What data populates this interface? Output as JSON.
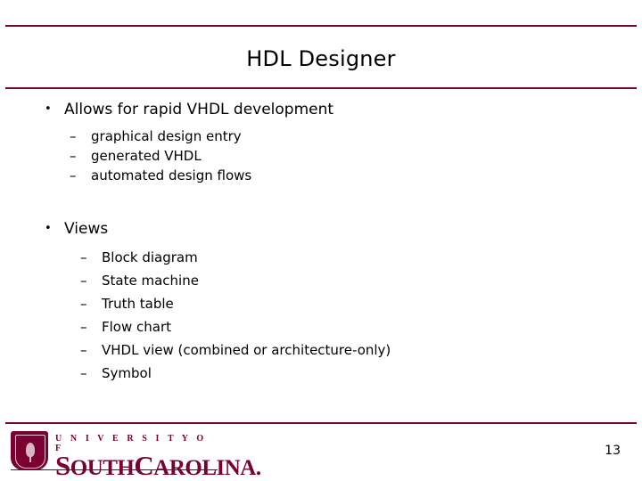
{
  "slide": {
    "title": "HDL Designer",
    "page_number": "13",
    "accent_color": "#7b0032",
    "bullet_marker_level1": "•",
    "bullet_marker_level2": "–",
    "groups": [
      {
        "heading": "Allows for rapid VHDL development",
        "items": [
          "graphical design entry",
          "generated VHDL",
          "automated design flows"
        ]
      },
      {
        "heading": "Views",
        "items": [
          "Block diagram",
          "State machine",
          "Truth table",
          "Flow chart",
          "VHDL view (combined or architecture-only)",
          "Symbol"
        ]
      }
    ]
  },
  "footer": {
    "logo": {
      "line1": "U N I V E R S I T Y   O F",
      "line2_cap_s": "S",
      "line2_rest1": "OUTH",
      "line2_cap_c": "C",
      "line2_rest2": "AROLINA."
    }
  }
}
